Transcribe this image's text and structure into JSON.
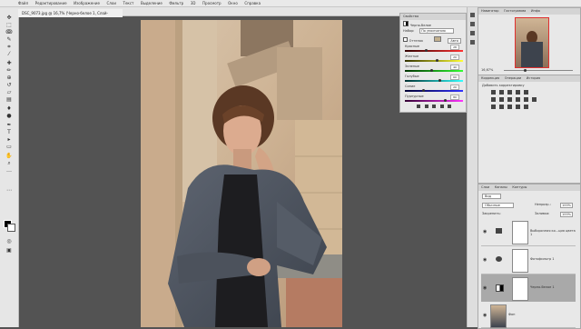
{
  "app": {
    "name": "Photoshop"
  },
  "menubar": {
    "items": [
      "Файл",
      "Редактирование",
      "Изображение",
      "Слои",
      "Текст",
      "Выделение",
      "Фильтр",
      "3D",
      "Просмотр",
      "Окно",
      "Справка"
    ]
  },
  "document_tab": {
    "title": "DSC_9073.jpg @ 16,7% (Черно-белое 1, Слой-маска/8) *",
    "close": "×"
  },
  "properties_panel": {
    "tabs": [
      "Свойства",
      "Черно-белое"
    ],
    "preset_label": "Набор:",
    "preset_value": "По умолчанию",
    "tint_label": "Оттенок",
    "auto_button": "Авто",
    "sliders": [
      {
        "label": "Красные",
        "value": "28"
      },
      {
        "label": "Желтые",
        "value": "20"
      },
      {
        "label": "Зеленые",
        "value": "40"
      },
      {
        "label": "Голубые",
        "value": "60"
      },
      {
        "label": "Синие",
        "value": "20"
      },
      {
        "label": "Пурпурные",
        "value": "80"
      }
    ],
    "slider_levels": [
      0.35,
      0.55,
      0.45,
      0.6,
      0.3,
      0.7
    ]
  },
  "navigator_panel": {
    "tabs": [
      "Навигатор",
      "Гистограмма",
      "Инфо"
    ],
    "zoom": "16,67%"
  },
  "adjustments_panel": {
    "tabs": [
      "Коррекция",
      "Операции",
      "История"
    ],
    "add_label": "Добавить корректировку"
  },
  "layers_panel": {
    "tabs": [
      "Слои",
      "Каналы",
      "Контуры"
    ],
    "kind_label": "Вид",
    "blend_mode": "Обычные",
    "opacity_label": "Непрозр.:",
    "opacity_value": "100%",
    "lock_label": "Закрепить:",
    "fill_label": "Заливка:",
    "fill_value": "100%",
    "layers": [
      {
        "name": "Выборочная ко...ция цвета 1",
        "selected": false
      },
      {
        "name": "Фотофильтр 1",
        "selected": false
      },
      {
        "name": "Черно-белое 1",
        "selected": true
      },
      {
        "name": "Фон",
        "selected": false
      }
    ]
  },
  "tools": [
    "move-tool",
    "marquee-tool",
    "lasso-tool",
    "quick-select-tool",
    "crop-tool",
    "eyedropper-tool",
    "healing-tool",
    "brush-tool",
    "clone-tool",
    "history-brush-tool",
    "eraser-tool",
    "gradient-tool",
    "blur-tool",
    "dodge-tool",
    "pen-tool",
    "type-tool",
    "path-select-tool",
    "shape-tool",
    "hand-tool",
    "zoom-tool"
  ]
}
